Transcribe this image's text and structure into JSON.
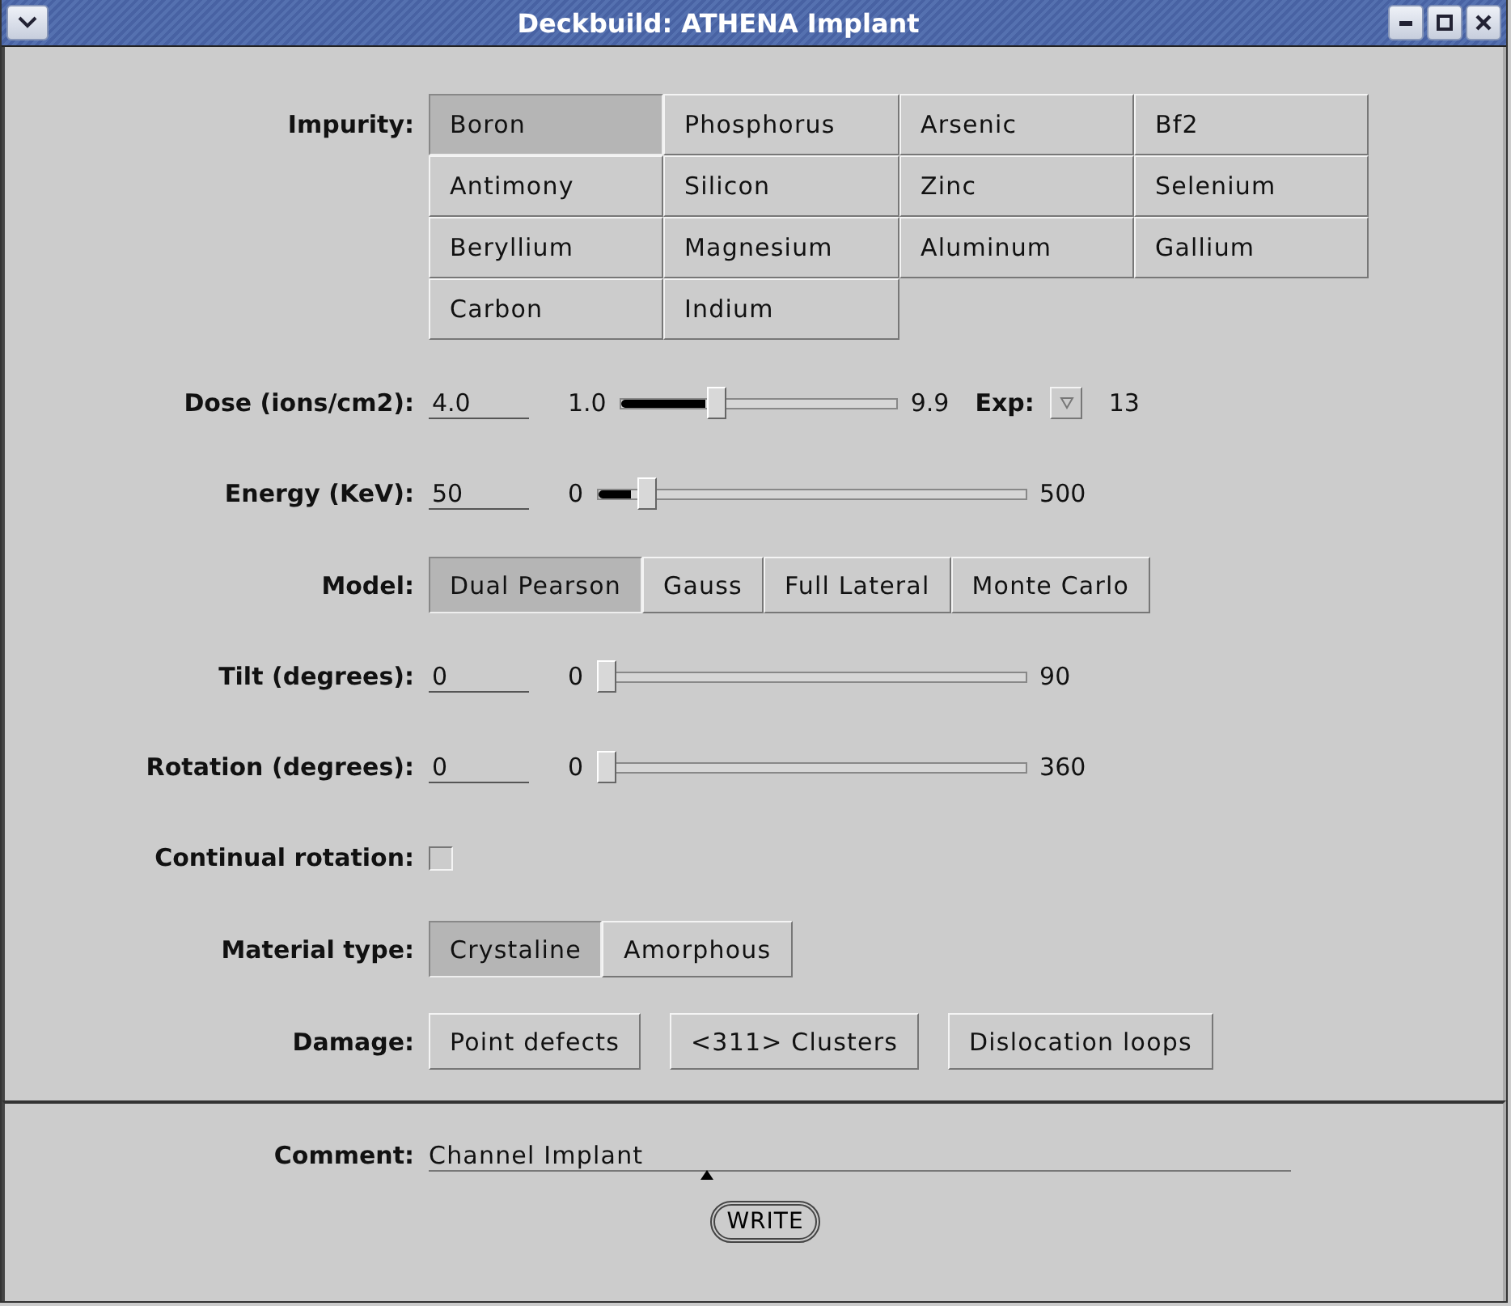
{
  "window": {
    "title": "Deckbuild: ATHENA Implant"
  },
  "form": [
    {
      "kind": "choice-grid",
      "label": "Impurity:",
      "options": [
        {
          "label": "Boron",
          "selected": true
        },
        {
          "label": "Phosphorus",
          "selected": false
        },
        {
          "label": "Arsenic",
          "selected": false
        },
        {
          "label": "Bf2",
          "selected": false
        },
        {
          "label": "Antimony",
          "selected": false
        },
        {
          "label": "Silicon",
          "selected": false
        },
        {
          "label": "Zinc",
          "selected": false
        },
        {
          "label": "Selenium",
          "selected": false
        },
        {
          "label": "Beryllium",
          "selected": false
        },
        {
          "label": "Magnesium",
          "selected": false
        },
        {
          "label": "Aluminum",
          "selected": false
        },
        {
          "label": "Gallium",
          "selected": false
        },
        {
          "label": "Carbon",
          "selected": false
        },
        {
          "label": "Indium",
          "selected": false
        }
      ]
    },
    {
      "kind": "slider",
      "label": "Dose (ions/cm2):",
      "value": "4.0",
      "min": "1.0",
      "max": "9.9",
      "level": 0.34,
      "exponent": {
        "label": "Exp:",
        "value": "13"
      }
    },
    {
      "kind": "slider",
      "label": "Energy (KeV):",
      "value": "50",
      "min": "0",
      "max": "500",
      "level": 0.1
    },
    {
      "kind": "choice-row",
      "label": "Model:",
      "options": [
        {
          "label": "Dual Pearson",
          "selected": true
        },
        {
          "label": "Gauss",
          "selected": false
        },
        {
          "label": "Full Lateral",
          "selected": false
        },
        {
          "label": "Monte Carlo",
          "selected": false
        }
      ]
    },
    {
      "kind": "slider",
      "label": "Tilt (degrees):",
      "value": "0",
      "min": "0",
      "max": "90",
      "level": 0
    },
    {
      "kind": "slider",
      "label": "Rotation (degrees):",
      "value": "0",
      "min": "0",
      "max": "360",
      "level": 0
    },
    {
      "kind": "checkbox",
      "label": "Continual rotation:",
      "checked": false
    },
    {
      "kind": "choice-row",
      "label": "Material type:",
      "options": [
        {
          "label": "Crystaline",
          "selected": true
        },
        {
          "label": "Amorphous",
          "selected": false
        }
      ]
    },
    {
      "kind": "button-row",
      "label": "Damage:",
      "buttons": [
        "Point defects",
        "<311> Clusters",
        "Dislocation loops"
      ]
    }
  ],
  "comment": {
    "label": "Comment:",
    "value": "Channel Implant"
  },
  "write_button": "WRITE"
}
